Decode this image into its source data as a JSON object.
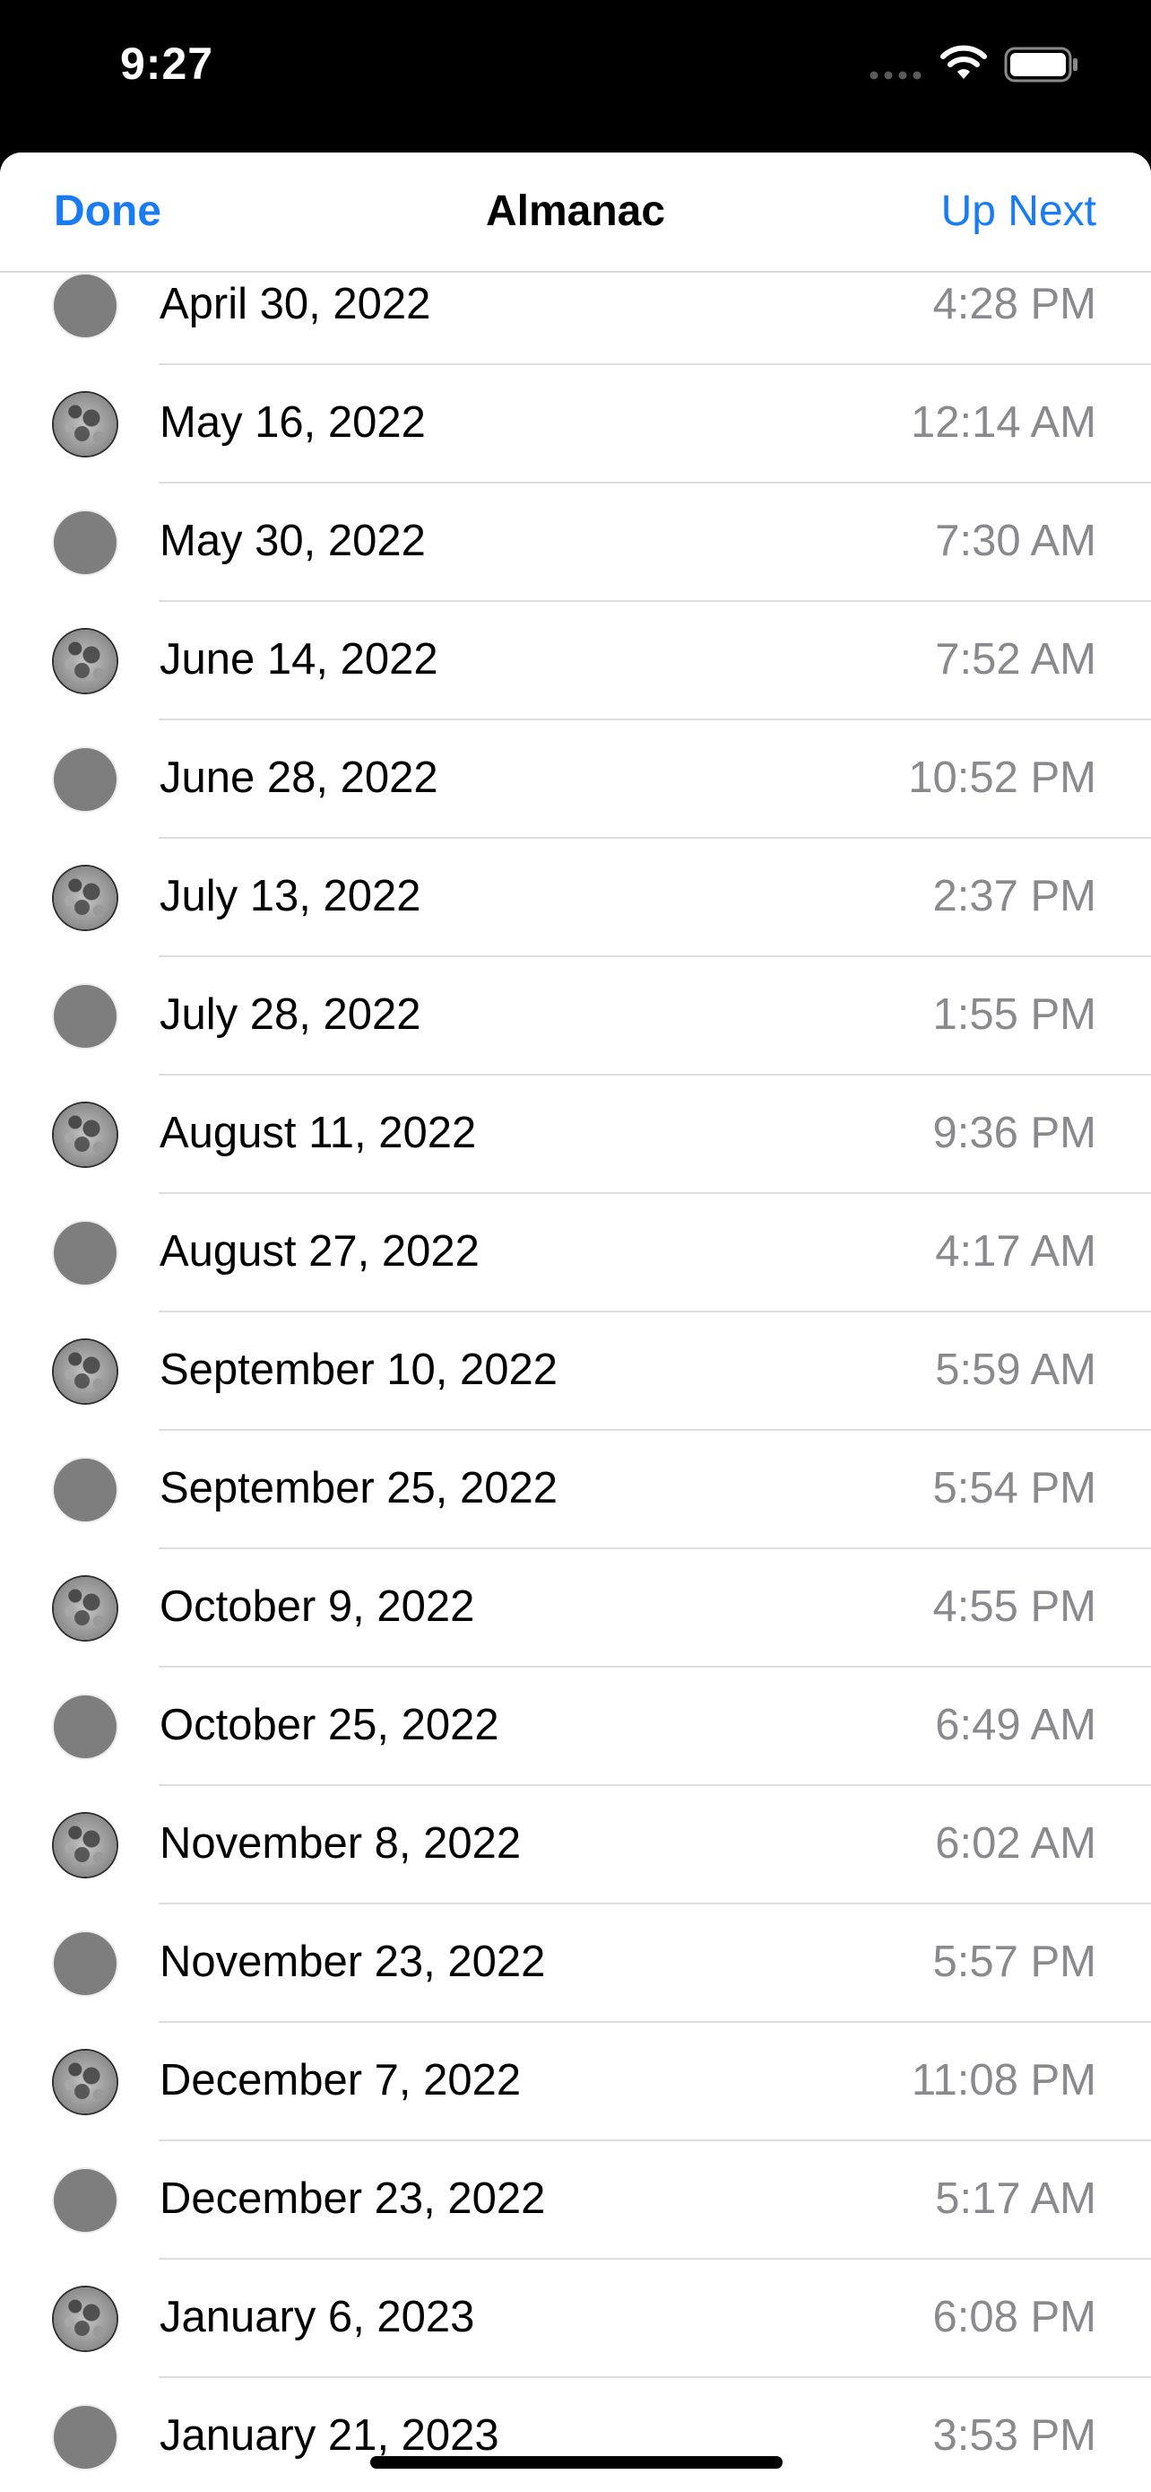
{
  "status_bar": {
    "time": "9:27",
    "icons": [
      "signal-icon",
      "wifi-icon",
      "battery-icon"
    ]
  },
  "nav": {
    "done_label": "Done",
    "title": "Almanac",
    "up_next_label": "Up Next"
  },
  "colors": {
    "accent": "#1a7cf5",
    "secondary_text": "#8a8a8e",
    "separator": "#dedede"
  },
  "rows": [
    {
      "date": "April 30, 2022",
      "time": "4:28 PM",
      "phase": "new"
    },
    {
      "date": "May 16, 2022",
      "time": "12:14 AM",
      "phase": "full"
    },
    {
      "date": "May 30, 2022",
      "time": "7:30 AM",
      "phase": "new"
    },
    {
      "date": "June 14, 2022",
      "time": "7:52 AM",
      "phase": "full"
    },
    {
      "date": "June 28, 2022",
      "time": "10:52 PM",
      "phase": "new"
    },
    {
      "date": "July 13, 2022",
      "time": "2:37 PM",
      "phase": "full"
    },
    {
      "date": "July 28, 2022",
      "time": "1:55 PM",
      "phase": "new"
    },
    {
      "date": "August 11, 2022",
      "time": "9:36 PM",
      "phase": "full"
    },
    {
      "date": "August 27, 2022",
      "time": "4:17 AM",
      "phase": "new"
    },
    {
      "date": "September 10, 2022",
      "time": "5:59 AM",
      "phase": "full"
    },
    {
      "date": "September 25, 2022",
      "time": "5:54 PM",
      "phase": "new"
    },
    {
      "date": "October 9, 2022",
      "time": "4:55 PM",
      "phase": "full"
    },
    {
      "date": "October 25, 2022",
      "time": "6:49 AM",
      "phase": "new"
    },
    {
      "date": "November 8, 2022",
      "time": "6:02 AM",
      "phase": "full"
    },
    {
      "date": "November 23, 2022",
      "time": "5:57 PM",
      "phase": "new"
    },
    {
      "date": "December 7, 2022",
      "time": "11:08 PM",
      "phase": "full"
    },
    {
      "date": "December 23, 2022",
      "time": "5:17 AM",
      "phase": "new"
    },
    {
      "date": "January 6, 2023",
      "time": "6:08 PM",
      "phase": "full"
    },
    {
      "date": "January 21, 2023",
      "time": "3:53 PM",
      "phase": "new"
    }
  ]
}
